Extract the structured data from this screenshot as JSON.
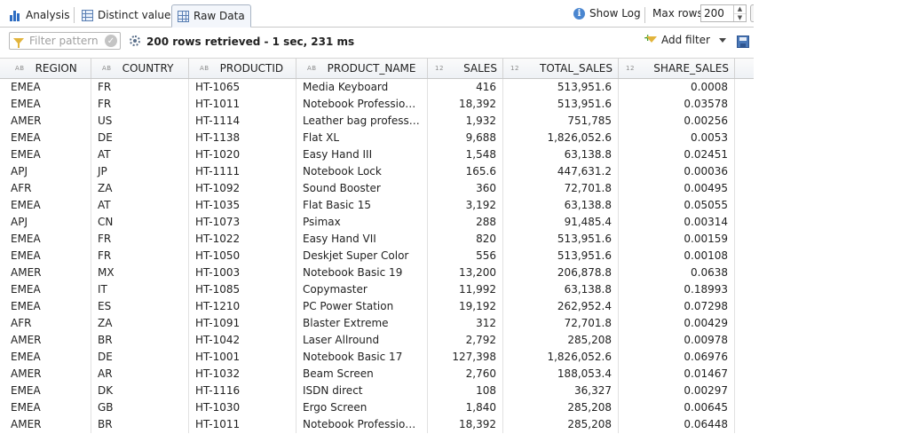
{
  "tabs": {
    "analysis": "Analysis",
    "distinct": "Distinct values",
    "raw": "Raw Data"
  },
  "toolbar": {
    "show_log": "Show Log",
    "max_rows_label": "Max rows:",
    "max_rows_value": "200"
  },
  "filterbar": {
    "placeholder": "Filter pattern",
    "status": "200 rows retrieved - 1 sec, 231 ms",
    "add_filter": "Add filter"
  },
  "columns": [
    {
      "label": "REGION",
      "type": "AB"
    },
    {
      "label": "COUNTRY",
      "type": "AB"
    },
    {
      "label": "PRODUCTID",
      "type": "AB"
    },
    {
      "label": "PRODUCT_NAME",
      "type": "AB"
    },
    {
      "label": "SALES",
      "type": "12"
    },
    {
      "label": "TOTAL_SALES",
      "type": "12"
    },
    {
      "label": "SHARE_SALES",
      "type": "12"
    }
  ],
  "rows": [
    [
      "EMEA",
      "FR",
      "HT-1065",
      "Media Keyboard",
      "416",
      "513,951.6",
      "0.0008"
    ],
    [
      "EMEA",
      "FR",
      "HT-1011",
      "Notebook Professional ...",
      "18,392",
      "513,951.6",
      "0.03578"
    ],
    [
      "AMER",
      "US",
      "HT-1114",
      "Leather bag professional",
      "1,932",
      "751,785",
      "0.00256"
    ],
    [
      "EMEA",
      "DE",
      "HT-1138",
      "Flat XL",
      "9,688",
      "1,826,052.6",
      "0.0053"
    ],
    [
      "EMEA",
      "AT",
      "HT-1020",
      "Easy Hand III",
      "1,548",
      "63,138.8",
      "0.02451"
    ],
    [
      "APJ",
      "JP",
      "HT-1111",
      "Notebook Lock",
      "165.6",
      "447,631.2",
      "0.00036"
    ],
    [
      "AFR",
      "ZA",
      "HT-1092",
      "Sound Booster",
      "360",
      "72,701.8",
      "0.00495"
    ],
    [
      "EMEA",
      "AT",
      "HT-1035",
      "Flat Basic 15",
      "3,192",
      "63,138.8",
      "0.05055"
    ],
    [
      "APJ",
      "CN",
      "HT-1073",
      "Psimax",
      "288",
      "91,485.4",
      "0.00314"
    ],
    [
      "EMEA",
      "FR",
      "HT-1022",
      "Easy Hand VII",
      "820",
      "513,951.6",
      "0.00159"
    ],
    [
      "EMEA",
      "FR",
      "HT-1050",
      "Deskjet Super Color",
      "556",
      "513,951.6",
      "0.00108"
    ],
    [
      "AMER",
      "MX",
      "HT-1003",
      "Notebook Basic 19",
      "13,200",
      "206,878.8",
      "0.0638"
    ],
    [
      "EMEA",
      "IT",
      "HT-1085",
      "Copymaster",
      "11,992",
      "63,138.8",
      "0.18993"
    ],
    [
      "EMEA",
      "ES",
      "HT-1210",
      "PC Power Station",
      "19,192",
      "262,952.4",
      "0.07298"
    ],
    [
      "AFR",
      "ZA",
      "HT-1091",
      "Blaster Extreme",
      "312",
      "72,701.8",
      "0.00429"
    ],
    [
      "AMER",
      "BR",
      "HT-1042",
      "Laser Allround",
      "2,792",
      "285,208",
      "0.00978"
    ],
    [
      "EMEA",
      "DE",
      "HT-1001",
      "Notebook Basic 17",
      "127,398",
      "1,826,052.6",
      "0.06976"
    ],
    [
      "AMER",
      "AR",
      "HT-1032",
      "Beam Screen",
      "2,760",
      "188,053.4",
      "0.01467"
    ],
    [
      "EMEA",
      "DK",
      "HT-1116",
      "ISDN direct",
      "108",
      "36,327",
      "0.00297"
    ],
    [
      "EMEA",
      "GB",
      "HT-1030",
      "Ergo Screen",
      "1,840",
      "285,208",
      "0.00645"
    ],
    [
      "AMER",
      "BR",
      "HT-1011",
      "Notebook Professional ...",
      "18,392",
      "285,208",
      "0.06448"
    ]
  ]
}
